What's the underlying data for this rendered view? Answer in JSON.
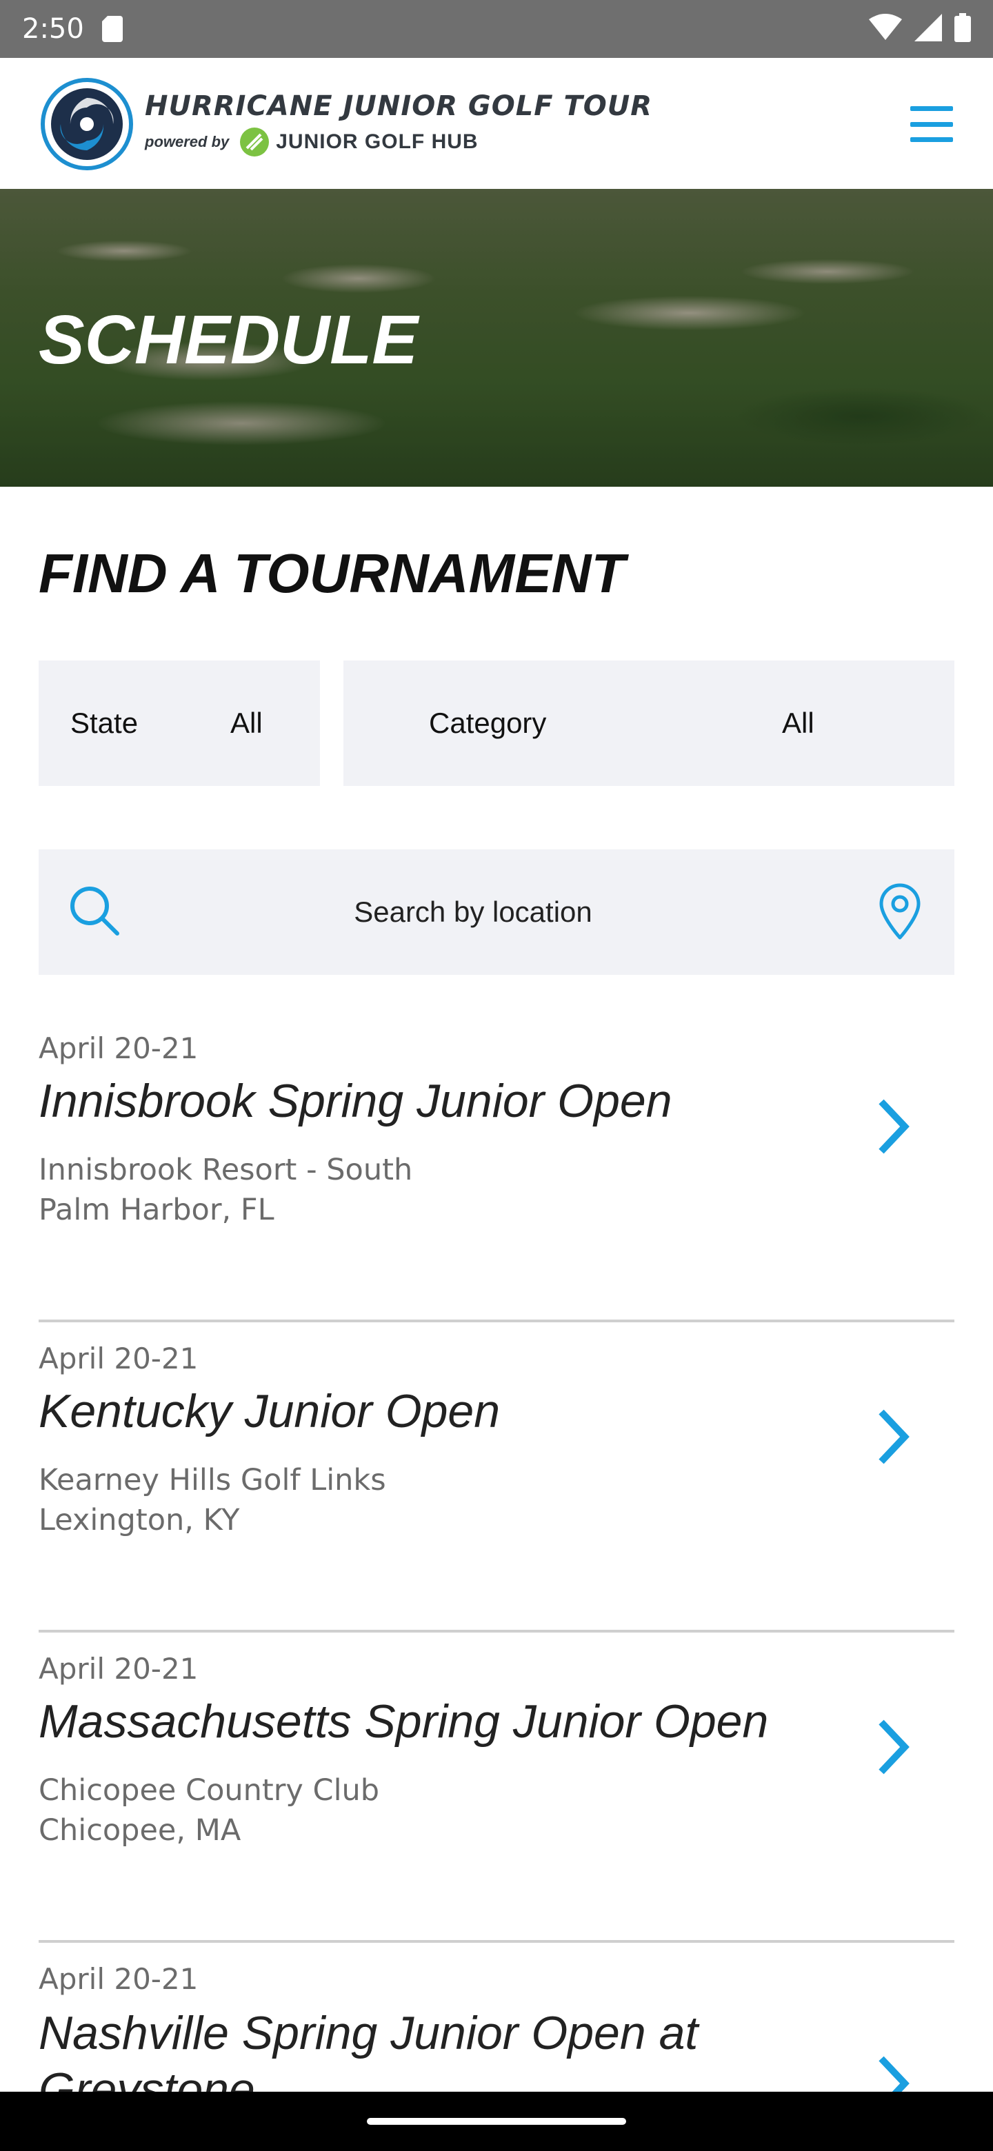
{
  "status_bar": {
    "time": "2:50"
  },
  "header": {
    "logo_title": "HURRICANE JUNIOR GOLF TOUR",
    "logo_powered_by": "powered by",
    "logo_hub": "JUNIOR GOLF HUB",
    "accent_color": "#1a9fe0",
    "menu_icon": "hamburger-menu-icon"
  },
  "hero": {
    "title": "SCHEDULE"
  },
  "finder": {
    "title": "FIND A TOURNAMENT",
    "state": {
      "label": "State",
      "value": "All"
    },
    "category": {
      "label": "Category",
      "value": "All"
    },
    "search_placeholder": "Search by location"
  },
  "tournaments": [
    {
      "date": "April 20-21",
      "name": "Innisbrook Spring Junior Open",
      "venue": "Innisbrook Resort - South",
      "city": "Palm Harbor, FL"
    },
    {
      "date": "April 20-21",
      "name": "Kentucky Junior Open",
      "venue": "Kearney Hills Golf Links",
      "city": "Lexington, KY"
    },
    {
      "date": "April 20-21",
      "name": "Massachusetts Spring Junior Open",
      "venue": "Chicopee Country Club",
      "city": "Chicopee, MA"
    },
    {
      "date": "April 20-21",
      "name": "Nashville Spring Junior Open at Greystone",
      "venue": "",
      "city": ""
    }
  ]
}
